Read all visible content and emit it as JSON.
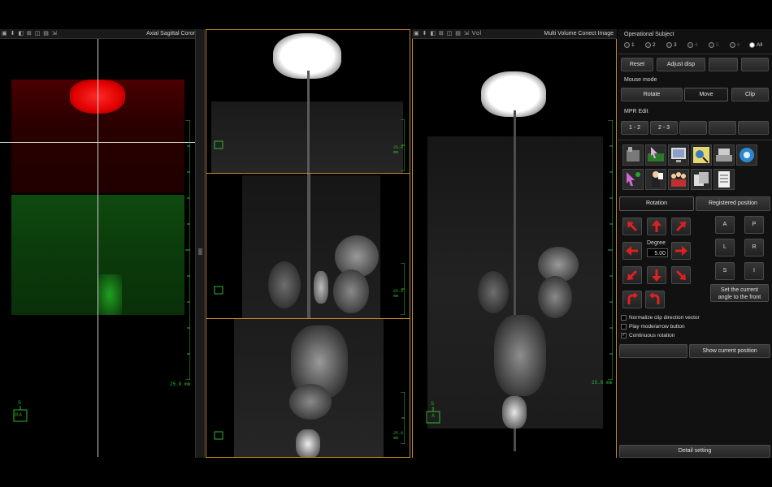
{
  "viewports": {
    "left": {
      "title": "Axial Sagittal Coronal",
      "scale": "25.0 mm",
      "orient": {
        "top": "S",
        "left": "R",
        "center": "A"
      }
    },
    "middle_top": {
      "scale": "25.0 mm"
    },
    "middle_mid": {
      "scale": "25.0 mm"
    },
    "middle_bot": {
      "scale": "25.0 mm"
    },
    "right": {
      "tab": "Vol",
      "title": "Multi Volume  Conect Image",
      "scale": "25.0 mm",
      "orient": {
        "top": "S",
        "center": "A"
      }
    }
  },
  "panel": {
    "operational_subject": {
      "label": "Operational Subject",
      "options": [
        "1",
        "2",
        "3",
        "4",
        "5",
        "6",
        "All"
      ],
      "selected": "All"
    },
    "top_buttons": {
      "reset": "Reset",
      "adjust_disp": "Adjust disp"
    },
    "mouse_mode": {
      "label": "Mouse mode",
      "rotate": "Rotate",
      "move": "Move",
      "clip": "Clip"
    },
    "mpr_edit": {
      "label": "MPR Edit",
      "b1": "1 - 2",
      "b2": "2 - 3"
    },
    "tabs": {
      "rotation": "Rotation",
      "registered_position": "Registered position"
    },
    "degree": {
      "label": "Degree",
      "value": "5.00"
    },
    "position_buttons": [
      "A",
      "P",
      "L",
      "R",
      "S",
      "I"
    ],
    "set_current": {
      "line1": "Set the current",
      "line2": "angle to the front"
    },
    "checks": [
      {
        "label": "Normalize clip direction vector",
        "checked": false
      },
      {
        "label": "Play mode/arrow button",
        "checked": false
      },
      {
        "label": "Continuous rotation",
        "checked": true
      }
    ],
    "show_current_position": "Show current position",
    "detail_setting": "Detail setting"
  }
}
